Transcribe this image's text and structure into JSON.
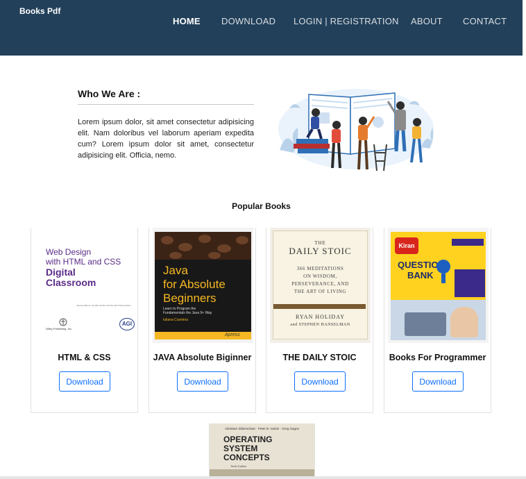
{
  "brand": "Books Pdf",
  "nav": [
    {
      "label": "HOME",
      "active": true
    },
    {
      "label": "DOWNLOAD",
      "active": false
    },
    {
      "label": "LOGIN | REGISTRATION",
      "active": false
    },
    {
      "label": "ABOUT",
      "active": false
    },
    {
      "label": "CONTACT",
      "active": false
    }
  ],
  "about": {
    "title": "Who We Are :",
    "text": "Lorem ipsum dolor, sit amet consectetur adipisicing elit. Nam doloribus vel laborum aperiam expedita cum? Lorem ipsum dolor sit amet, consectetur adipisicing elit. Officia, nemo."
  },
  "popular": {
    "title": "Popular Books",
    "button_label": "Download",
    "books": [
      {
        "title": "HTML & CSS",
        "cover": {
          "lines": [
            "Web Design",
            "with HTML and CSS"
          ],
          "bold_lines": [
            "Digital",
            "Classroom"
          ],
          "authors": "Jeremy Osborn, Jennifer Smith, and the AGI Training Team",
          "publisher": "Wiley Publishing, Inc.",
          "badge": "AGI"
        }
      },
      {
        "title": "JAVA Absolute Biginner",
        "cover": {
          "lines": [
            "Java",
            "for Absolute",
            "Beginners"
          ],
          "subtitle": "Learn to Program the Fundamentals the Java 9+ Way",
          "author": "Iuliana Cosmina",
          "publisher": "Apress"
        }
      },
      {
        "title": "THE DAILY STOIC",
        "cover": {
          "lines": [
            "THE",
            "DAILY STOIC"
          ],
          "subtitle_lines": [
            "366 MEDITATIONS",
            "ON WISDOM,",
            "PERSEVERANCE, AND",
            "THE ART OF LIVING"
          ],
          "authors": [
            "RYAN HOLIDAY",
            "and STEPHEN HANSELMAN"
          ]
        }
      },
      {
        "title": "Books For Programmer",
        "cover": {
          "lines": [
            "QUESTION",
            "BANK"
          ],
          "badge": "Kiran"
        }
      }
    ],
    "partial_book": {
      "cover": {
        "authors": "Abraham Silberschatz · Peter B. Galvin · Greg Gagne",
        "lines": [
          "OPERATING",
          "SYSTEM",
          "CONCEPTS"
        ],
        "edition": "Tenth Edition"
      }
    }
  },
  "colors": {
    "navbar": "#22405a",
    "button_accent": "#0d6efd"
  }
}
